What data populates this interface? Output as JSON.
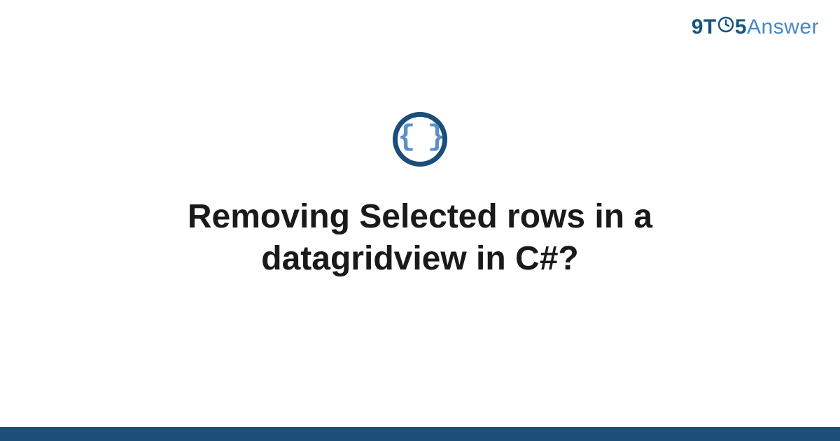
{
  "logo": {
    "part1": "9T",
    "part2": "5",
    "part3": "Answer"
  },
  "icon": {
    "name": "code-braces-icon",
    "glyph": "{ }"
  },
  "title": "Removing Selected rows in a datagridview in C#?",
  "colors": {
    "darkBlue": "#1c4e7a",
    "lightBlue": "#5b8fc7",
    "logoAnswer": "#4a86c5"
  }
}
